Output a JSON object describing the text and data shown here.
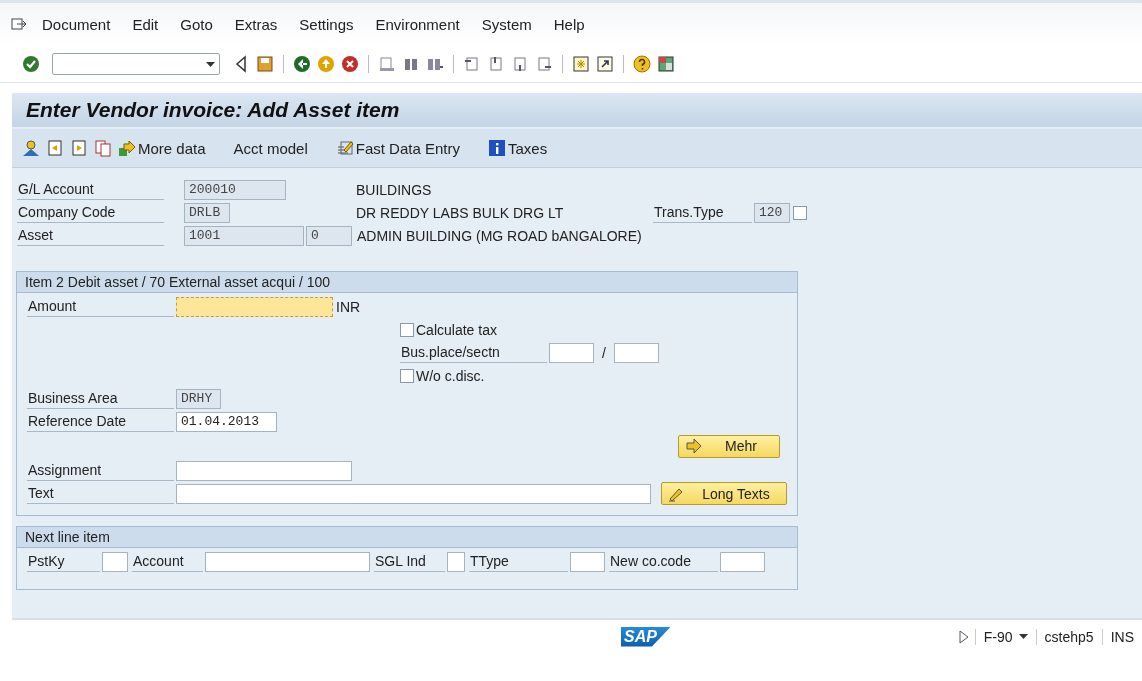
{
  "menu_bar": {
    "items": [
      "Document",
      "Edit",
      "Goto",
      "Extras",
      "Settings",
      "Environment",
      "System",
      "Help"
    ]
  },
  "title": "Enter Vendor invoice: Add Asset item",
  "app_toolbar": [
    {
      "kind": "arrow",
      "label": "More data"
    },
    {
      "kind": "plain",
      "label": "Acct model"
    },
    {
      "kind": "fast",
      "label": "Fast Data Entry"
    },
    {
      "kind": "info",
      "label": "Taxes"
    }
  ],
  "header": {
    "gl_account": {
      "label": "G/L Account",
      "value": "200010",
      "description": "BUILDINGS"
    },
    "company_code": {
      "label": "Company Code",
      "value": "DRLB",
      "description": "DR REDDY LABS BULK DRG LT"
    },
    "trans_type": {
      "label": "Trans.Type",
      "value": "120",
      "checked": false
    },
    "asset": {
      "label": "Asset",
      "value": "1001",
      "subnumber": "0",
      "description": "ADMIN BUILDING (MG ROAD bANGALORE)"
    }
  },
  "item_group": {
    "title": "Item 2 Debit asset / 70 External asset acqui / 100",
    "amount": {
      "label": "Amount",
      "currency": "INR",
      "focused": true
    },
    "calculate_tax": {
      "label": "Calculate tax",
      "checked": false
    },
    "bus_place": {
      "label": "Bus.place/sectn",
      "separator": "/"
    },
    "wo_cdisc": {
      "label": "W/o c.disc.",
      "checked": false
    },
    "business_area": {
      "label": "Business Area",
      "value": "DRHY"
    },
    "reference_date": {
      "label": "Reference Date",
      "value": "01.04.2013"
    },
    "mehr_button": "Mehr",
    "assignment": {
      "label": "Assignment"
    },
    "text": {
      "label": "Text"
    },
    "long_texts_button": "Long Texts"
  },
  "next_line_group": {
    "title": "Next line item",
    "fields": [
      {
        "label": "PstKy"
      },
      {
        "label": "Account"
      },
      {
        "label": "SGL Ind"
      },
      {
        "label": "TType"
      },
      {
        "label": "New co.code"
      }
    ]
  },
  "status_bar": {
    "logo": "SAP",
    "transaction": "F-90",
    "server": "cstehp5",
    "mode": "INS"
  }
}
